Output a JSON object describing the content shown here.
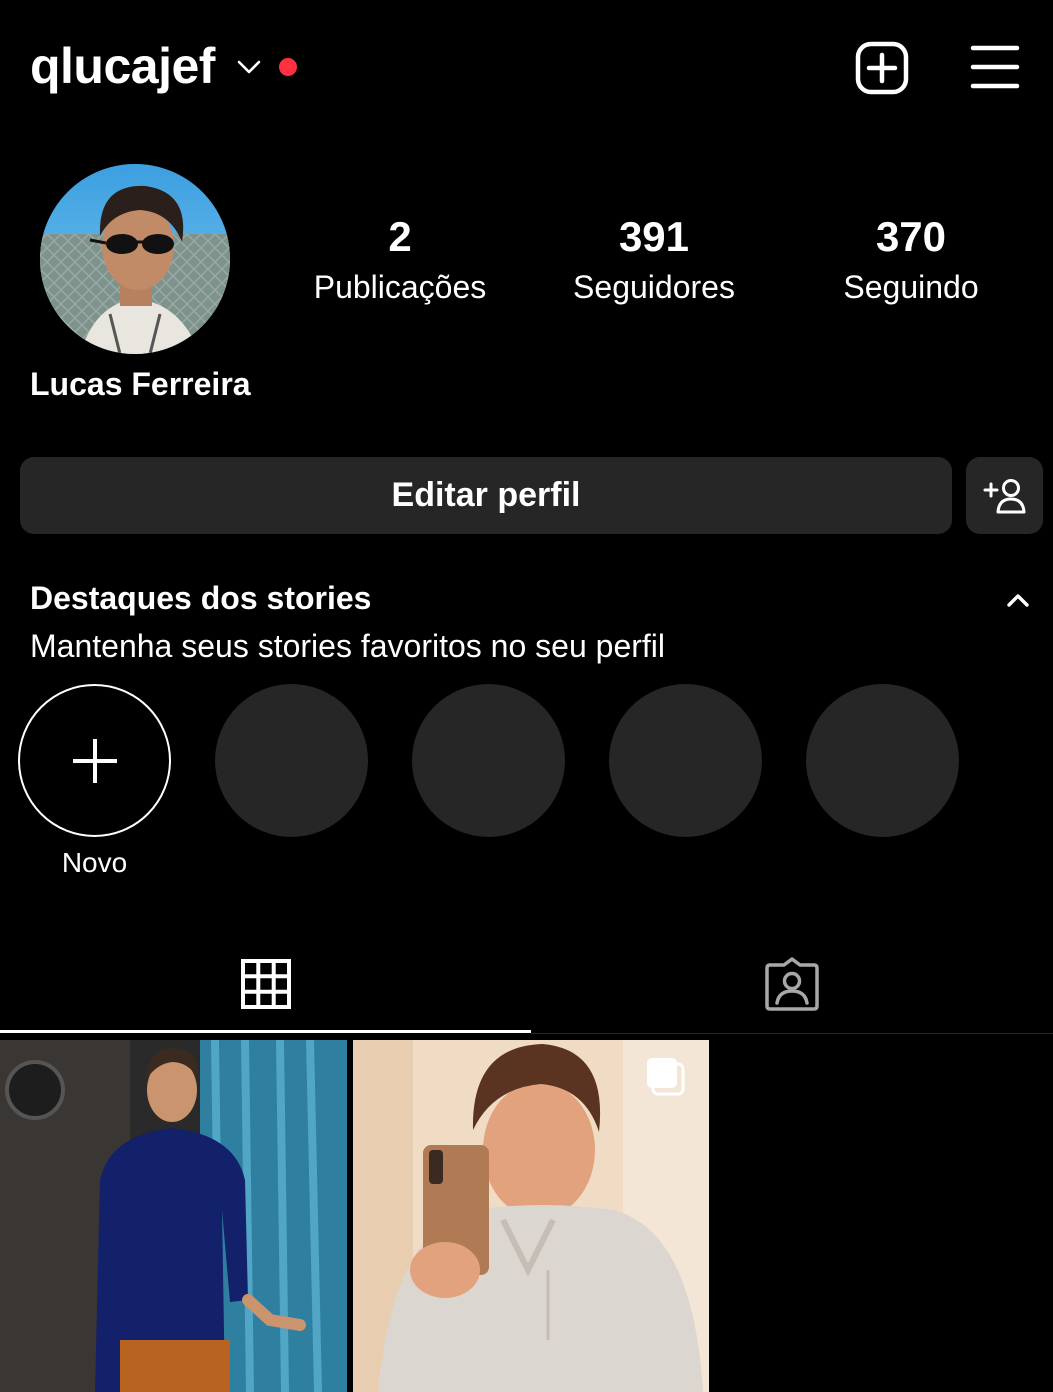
{
  "header": {
    "username": "qlucajef",
    "notification_color": "#ff3040"
  },
  "profile": {
    "full_name": "Lucas Ferreira",
    "stats": [
      {
        "value": "2",
        "label": "Publicações"
      },
      {
        "value": "391",
        "label": "Seguidores"
      },
      {
        "value": "370",
        "label": "Seguindo"
      }
    ]
  },
  "actions": {
    "edit_label": "Editar perfil"
  },
  "highlights": {
    "title": "Destaques dos stories",
    "subtitle": "Mantenha seus stories favoritos no seu perfil",
    "new_label": "Novo",
    "placeholder_count": 4
  },
  "tabs": [
    "grid-icon",
    "tagged-icon"
  ],
  "colors": {
    "background": "#000000",
    "button_bg": "#262626",
    "text": "#ffffff"
  }
}
